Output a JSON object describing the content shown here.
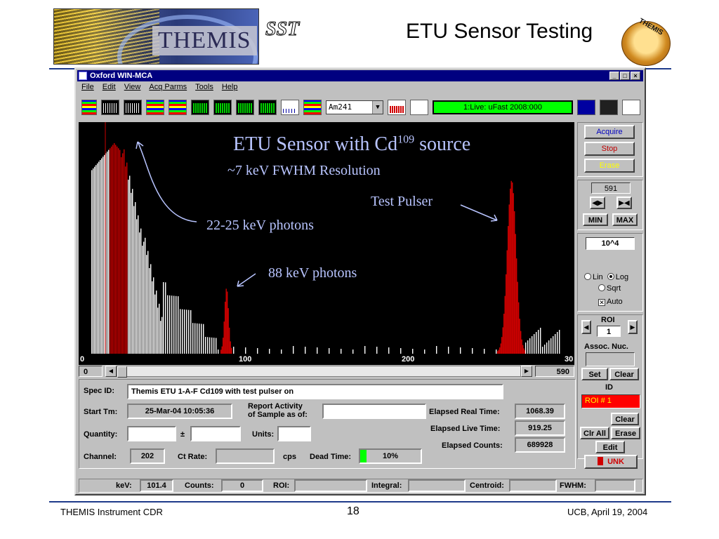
{
  "slide": {
    "logo_text": "THEMIS",
    "sst_text": "SST",
    "title": "ETU Sensor Testing",
    "emblem_text": "THEMIS",
    "footer_left": "THEMIS Instrument CDR",
    "page_number": "18",
    "footer_right": "UCB, April 19, 2004"
  },
  "window": {
    "title": "Oxford WIN-MCA",
    "controls": [
      "_",
      "□",
      "×"
    ],
    "menu": [
      "File",
      "Edit",
      "View",
      "Acq Parms",
      "Tools",
      "Help"
    ],
    "toolbar": {
      "source_combo": "Am241",
      "status": "1:Live:  uFast  2008:000"
    }
  },
  "annotations": {
    "headline_main": "ETU Sensor with Cd",
    "headline_sup": "109",
    "headline_tail": " source",
    "resolution": "~7 keV FWHM Resolution",
    "test_pulser": "Test Pulser",
    "photons_low": "22-25 keV photons",
    "photons_high": "88 keV photons"
  },
  "axis": {
    "ticks": [
      "0",
      "100",
      "200",
      "30"
    ],
    "scroll_left": "0",
    "scroll_right": "590"
  },
  "panel": {
    "acquire": "Acquire",
    "stop": "Stop",
    "erase": "Erase",
    "cursor_value": "591",
    "min": "MIN",
    "max": "MAX",
    "scale_value": "10^4",
    "lin": "Lin",
    "log": "Log",
    "sqrt": "Sqrt",
    "auto": "Auto",
    "roi_label": "ROI",
    "roi_value": "1",
    "assoc_nuc": "Assoc. Nuc.",
    "set": "Set",
    "clear": "Clear",
    "id": "ID",
    "roi_id": "ROI # 1",
    "clear2": "Clear",
    "clr_all": "Clr All",
    "erase2": "Erase",
    "edit": "Edit",
    "unk": "UNK"
  },
  "info": {
    "spec_id_label": "Spec ID:",
    "spec_id": "Themis ETU 1-A-F Cd109 with test pulser on",
    "start_tm_label": "Start Tm:",
    "start_tm": "25-Mar-04 10:05:36",
    "report_activity_1": "Report Activity",
    "report_activity_2": "of Sample as of:",
    "quantity_label": "Quantity:",
    "plus_minus": "±",
    "units_label": "Units:",
    "channel_label": "Channel:",
    "channel": "202",
    "ct_rate_label": "Ct Rate:",
    "cps": "cps",
    "dead_time_label": "Dead Time:",
    "dead_time": "10%",
    "dead_time_fraction": 0.1,
    "elapsed_real_label": "Elapsed Real Time:",
    "elapsed_real": "1068.39",
    "elapsed_live_label": "Elapsed Live Time:",
    "elapsed_live": "919.25",
    "elapsed_counts_label": "Elapsed Counts:",
    "elapsed_counts": "689928"
  },
  "status_bar": {
    "kev_label": "keV:",
    "kev": "101.4",
    "counts_label": "Counts:",
    "counts": "0",
    "roi_label": "ROI:",
    "integral_label": "Integral:",
    "centroid_label": "Centroid:",
    "fwhm_label": "FWHM:"
  },
  "colors": {
    "roi_red": "#cc0000",
    "live_green": "#00ff00",
    "annotation": "#b8c4ff",
    "title_blue": "#000080"
  }
}
